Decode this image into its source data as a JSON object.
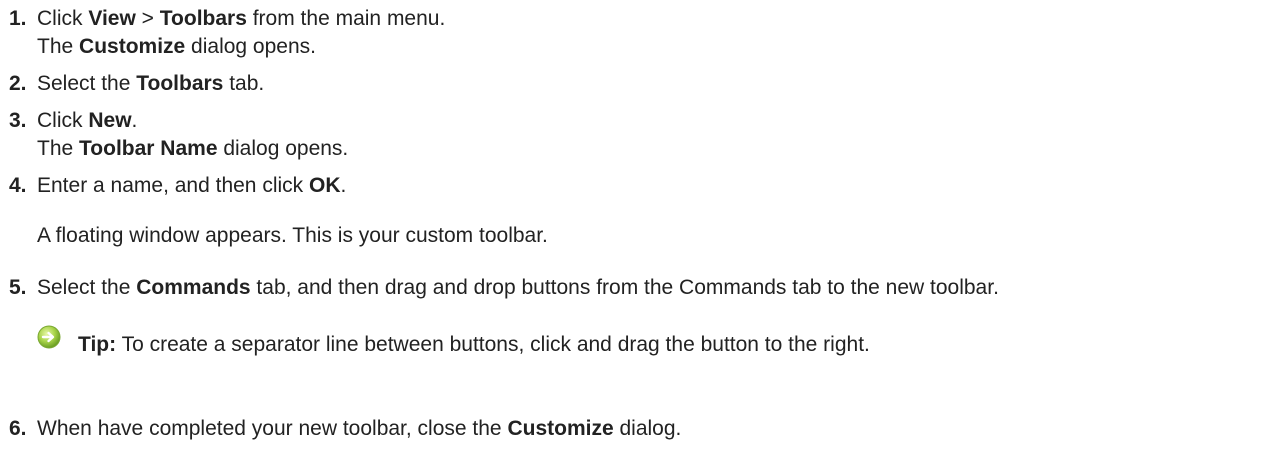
{
  "steps": [
    {
      "number": "1.",
      "parts": [
        "Click ",
        "View",
        " > ",
        "Toolbars",
        " from the main menu."
      ],
      "result_parts": [
        "The ",
        "Customize",
        " dialog opens."
      ]
    },
    {
      "number": "2.",
      "parts": [
        "Select the ",
        "Toolbars",
        " tab."
      ]
    },
    {
      "number": "3.",
      "parts": [
        "Click ",
        "New",
        "."
      ],
      "result_parts": [
        "The ",
        "Toolbar Name",
        " dialog opens."
      ]
    },
    {
      "number": "4.",
      "parts": [
        "Enter a name, and then click ",
        "OK",
        "."
      ],
      "note": "A floating window appears. This is your custom toolbar."
    },
    {
      "number": "5.",
      "parts": [
        "Select the ",
        "Commands",
        " tab, and then drag and drop buttons from the Commands tab to the new toolbar."
      ]
    },
    {
      "number": "6.",
      "parts": [
        "When have completed your new toolbar, close the ",
        "Customize",
        " dialog."
      ]
    }
  ],
  "tip": {
    "icon": "green-arrow-circle-icon",
    "label": "Tip:",
    "text": " To create a separator line between buttons, click and drag the button to the right."
  }
}
